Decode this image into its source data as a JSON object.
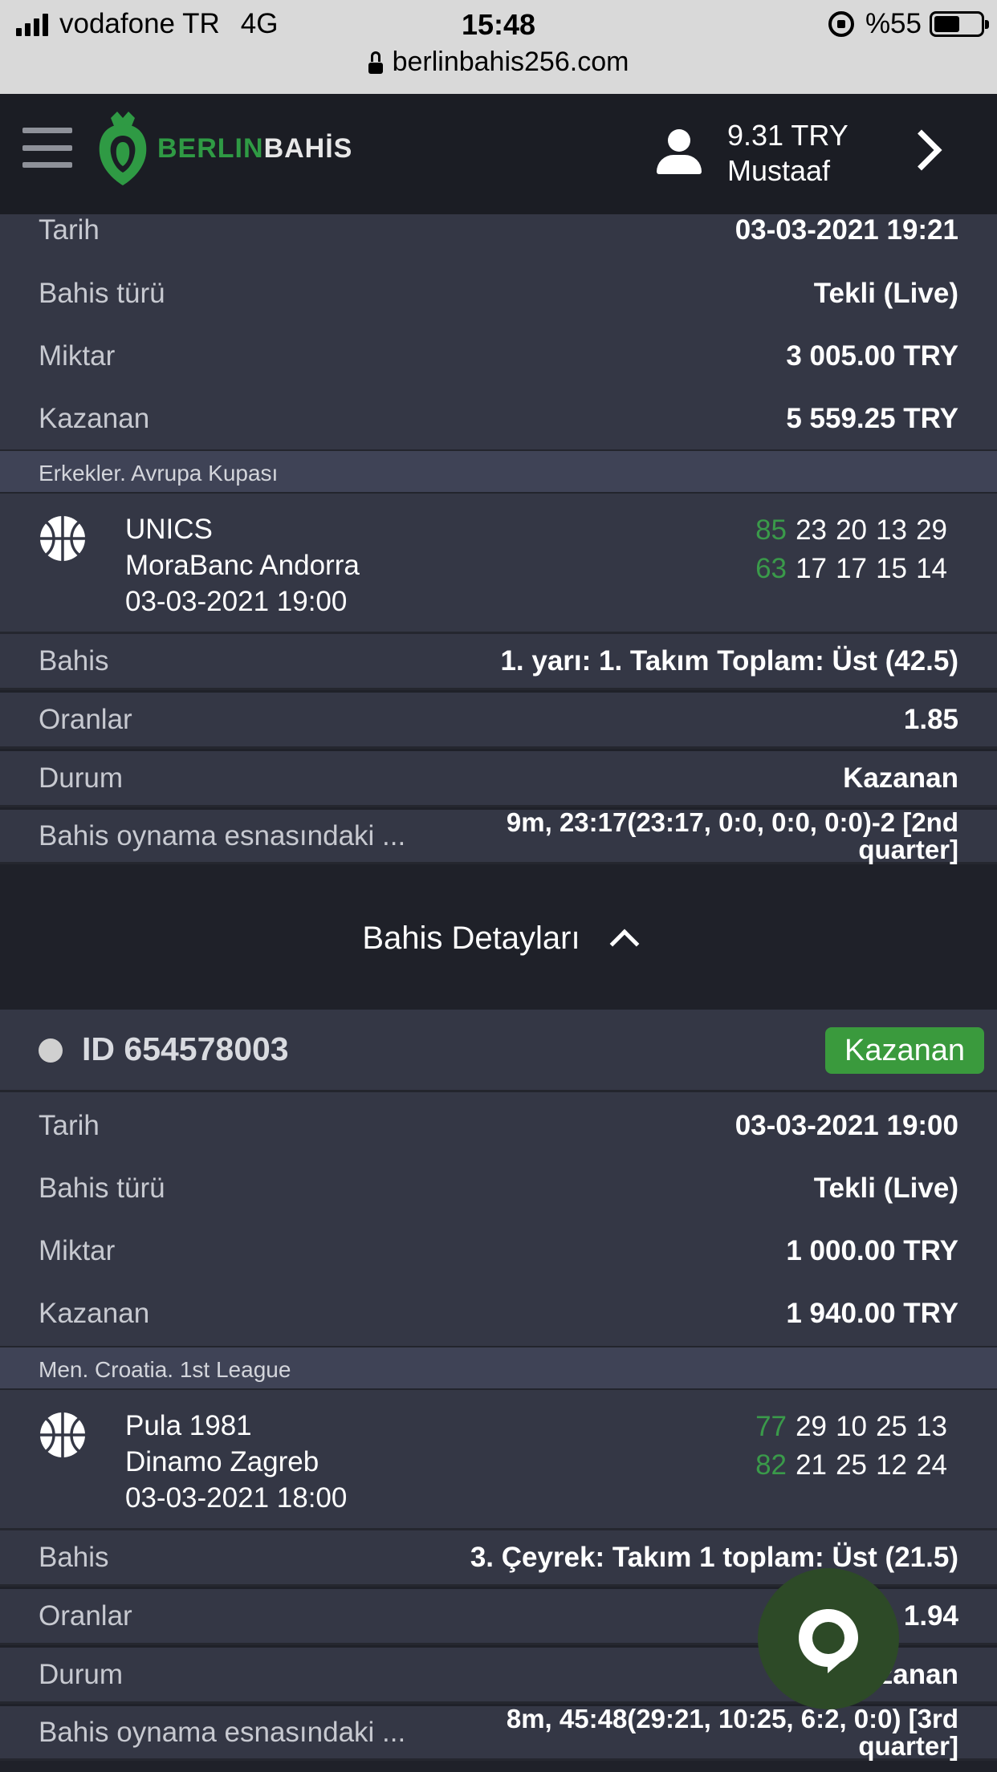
{
  "status_bar": {
    "carrier": "vodafone TR",
    "network": "4G",
    "time": "15:48",
    "battery": "%55",
    "battery_level": 0.55,
    "url": "berlinbahis256.com"
  },
  "header": {
    "logo_part1": "BERLIN",
    "logo_part2": "BAHİS",
    "balance": "9.31 TRY",
    "username": "Mustaaf"
  },
  "bet1": {
    "rows": [
      {
        "key": "Tarih",
        "value": "03-03-2021 19:21"
      },
      {
        "key": "Bahis türü",
        "value": "Tekli (Live)"
      },
      {
        "key": "Miktar",
        "value": "3 005.00 TRY"
      },
      {
        "key": "Kazanan",
        "value": "5 559.25 TRY"
      }
    ],
    "league": "Erkekler. Avrupa Kupası",
    "team1": "UNICS",
    "team2": "MoraBanc Andorra",
    "match_date": "03-03-2021 19:00",
    "team1_scores": {
      "total": "85",
      "q": [
        "23",
        "20",
        "13",
        "29"
      ]
    },
    "team2_scores": {
      "total": "63",
      "q": [
        "17",
        "17",
        "15",
        "14"
      ]
    },
    "details": [
      {
        "key": "Bahis",
        "value": "1. yarı: 1. Takım Toplam: Üst (42.5)"
      },
      {
        "key": "Oranlar",
        "value": "1.85"
      },
      {
        "key": "Durum",
        "value": "Kazanan"
      },
      {
        "key": "Bahis oynama esnasındaki ...",
        "value_line1": "9m, 23:17(23:17, 0:0, 0:0, 0:0)-2 [2nd",
        "value_line2": "quarter]"
      }
    ]
  },
  "toggle": {
    "label": "Bahis Detayları"
  },
  "bet2": {
    "id": "ID 654578003",
    "status": "Kazanan",
    "rows": [
      {
        "key": "Tarih",
        "value": "03-03-2021 19:00"
      },
      {
        "key": "Bahis türü",
        "value": "Tekli (Live)"
      },
      {
        "key": "Miktar",
        "value": "1 000.00 TRY"
      },
      {
        "key": "Kazanan",
        "value": "1 940.00 TRY"
      }
    ],
    "league": "Men. Croatia. 1st League",
    "team1": "Pula 1981",
    "team2": "Dinamo Zagreb",
    "match_date": "03-03-2021 18:00",
    "team1_scores": {
      "total": "77",
      "q": [
        "29",
        "10",
        "25",
        "13"
      ]
    },
    "team2_scores": {
      "total": "82",
      "q": [
        "21",
        "25",
        "12",
        "24"
      ]
    },
    "details": [
      {
        "key": "Bahis",
        "value": "3. Çeyrek: Takım 1 toplam: Üst (21.5)"
      },
      {
        "key": "Oranlar",
        "value": "1.94"
      },
      {
        "key": "Durum",
        "value": "Kazanan"
      },
      {
        "key": "Bahis oynama esnasındaki ...",
        "value_line1": "8m, 45:48(29:21, 10:25, 6:2, 0:0) [3rd",
        "value_line2": "quarter]"
      }
    ]
  },
  "colors": {
    "accent_green": "#3a9a3d",
    "panel": "#343745",
    "header": "#1b1d24"
  }
}
